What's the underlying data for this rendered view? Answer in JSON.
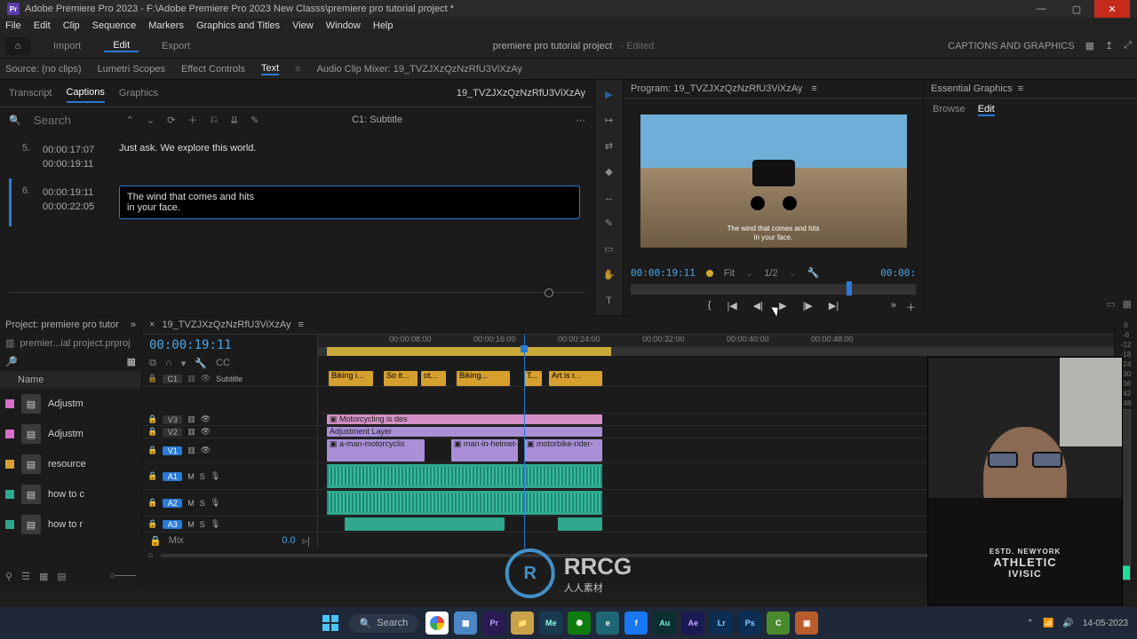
{
  "titlebar": {
    "app_icon_label": "Pr",
    "title": "Adobe Premiere Pro 2023 - F:\\Adobe Premiere Pro 2023 New Classs\\premiere pro tutorial project *"
  },
  "menubar": [
    "File",
    "Edit",
    "Clip",
    "Sequence",
    "Markers",
    "Graphics and Titles",
    "View",
    "Window",
    "Help"
  ],
  "workspace": {
    "tabs": [
      "Import",
      "Edit",
      "Export"
    ],
    "active": "Edit",
    "project_name": "premiere pro tutorial project",
    "edited_label": "- Edited",
    "right_label": "CAPTIONS AND GRAPHICS"
  },
  "source_tabs": {
    "items": [
      "Source: (no clips)",
      "Lumetri Scopes",
      "Effect Controls",
      "Text",
      "Audio Clip Mixer: 19_TVZJXzQzNzRfU3ViXzAy"
    ],
    "active": "Text"
  },
  "captions": {
    "tabs": [
      "Transcript",
      "Captions",
      "Graphics"
    ],
    "active_tab": "Captions",
    "filename": "19_TVZJXzQzNzRfU3ViXzAy",
    "search_placeholder": "Search",
    "track_label": "C1: Subtitle",
    "rows": [
      {
        "n": "5.",
        "t_in": "00:00:17:07",
        "t_out": "00:00:19:11",
        "text": "Just ask. We explore this world."
      },
      {
        "n": "6.",
        "t_in": "00:00:19:11",
        "t_out": "00:00:22:05",
        "text_l1": "The wind that comes and hits",
        "text_l2": "in your face."
      }
    ]
  },
  "program": {
    "header": "Program: 19_TVZJXzQzNzRfU3ViXzAy",
    "subtitle_l1": "The wind that comes and hits",
    "subtitle_l2": "in your face.",
    "timecode": "00:00:19:11",
    "fit": "Fit",
    "zoom": "1/2",
    "tc_right": "00:00:"
  },
  "essential": {
    "header": "Essential Graphics",
    "tabs": [
      "Browse",
      "Edit"
    ],
    "active": "Edit"
  },
  "project_panel": {
    "header": "Project: premiere pro tutor",
    "crumb": "premier...ial project.prproj",
    "name_header": "Name",
    "items": [
      {
        "color": "#d66ecb",
        "label": "Adjustm"
      },
      {
        "color": "#d66ecb",
        "label": "Adjustm"
      },
      {
        "color": "#d6a02e",
        "label": "resource"
      },
      {
        "color": "#2fa88d",
        "label": "how to c"
      },
      {
        "color": "#2fa88d",
        "label": "how to r"
      }
    ]
  },
  "timeline": {
    "seq_name": "19_TVZJXzQzNzRfU3ViXzAy",
    "timecode": "00:00:19:11",
    "ruler": [
      "00:00:08:00",
      "00:00:16:00",
      "00:00:24:00",
      "00:00:32:00",
      "00:00:40:00",
      "00:00:48:00"
    ],
    "subtitle_track_label": "Subtitle",
    "c1_label": "C1",
    "caption_clips": [
      "Biking i...",
      "So it...",
      "ot...",
      "Biking...",
      "T...",
      "Art is r..."
    ],
    "v3_label": "V3",
    "v2_label": "V2",
    "v1_label": "V1",
    "a1_label": "A1",
    "a2_label": "A2",
    "a3_label": "A3",
    "m_label": "M",
    "s_label": "S",
    "mix_label": "Mix",
    "mix_value": "0.0",
    "v3_clip": "Motorcycling is des",
    "v2_clip": "Adjustment Layer",
    "v1_clips": [
      "a-man-motorcyclis",
      "man-in-helmet-",
      "motorbike-rider-"
    ]
  },
  "audio_meter": {
    "ticks": [
      "0",
      "-6",
      "-12",
      "-18",
      "-24",
      "-30",
      "-36",
      "-42",
      "-48",
      "--"
    ]
  },
  "webcam": {
    "shirt_l1": "ESTD. NEWYORK",
    "shirt_l2": "ATHLETIC",
    "shirt_l3": "IVISIC"
  },
  "taskbar": {
    "search_label": "Search",
    "apps": [
      {
        "name": "chrome",
        "bg": "#fff",
        "txt": "",
        "ring": true
      },
      {
        "name": "calc",
        "bg": "#4b87c4",
        "txt": "▦"
      },
      {
        "name": "pr",
        "bg": "#2a1a52",
        "txt": "Pr",
        "fg": "#bda3ff"
      },
      {
        "name": "explorer",
        "bg": "#caa24a",
        "txt": "📁"
      },
      {
        "name": "me",
        "bg": "#1a3a52",
        "txt": "Me",
        "fg": "#8fd"
      },
      {
        "name": "xbox",
        "bg": "#107c10",
        "txt": "⚉"
      },
      {
        "name": "edge",
        "bg": "#1e6673",
        "txt": "e"
      },
      {
        "name": "fb",
        "bg": "#1877f2",
        "txt": "f"
      },
      {
        "name": "au",
        "bg": "#0b2e2e",
        "txt": "Au",
        "fg": "#7ed"
      },
      {
        "name": "ae",
        "bg": "#1a1a52",
        "txt": "Ae",
        "fg": "#bda3ff"
      },
      {
        "name": "lr",
        "bg": "#0b2e52",
        "txt": "Lr",
        "fg": "#8cf"
      },
      {
        "name": "ps",
        "bg": "#0b2e52",
        "txt": "Ps",
        "fg": "#8cf"
      },
      {
        "name": "camtasia",
        "bg": "#4a8a2e",
        "txt": "C"
      },
      {
        "name": "camtasia2",
        "bg": "#b85c2e",
        "txt": "▣"
      }
    ],
    "date": "14-05-2023"
  },
  "watermark": {
    "logo": "R",
    "brand": "RRCG",
    "sub": "人人素材"
  },
  "colors": {
    "accent": "#2a7ad6",
    "caption": "#d6a02e",
    "video": "#a98fd6",
    "audio": "#2fa88d"
  }
}
